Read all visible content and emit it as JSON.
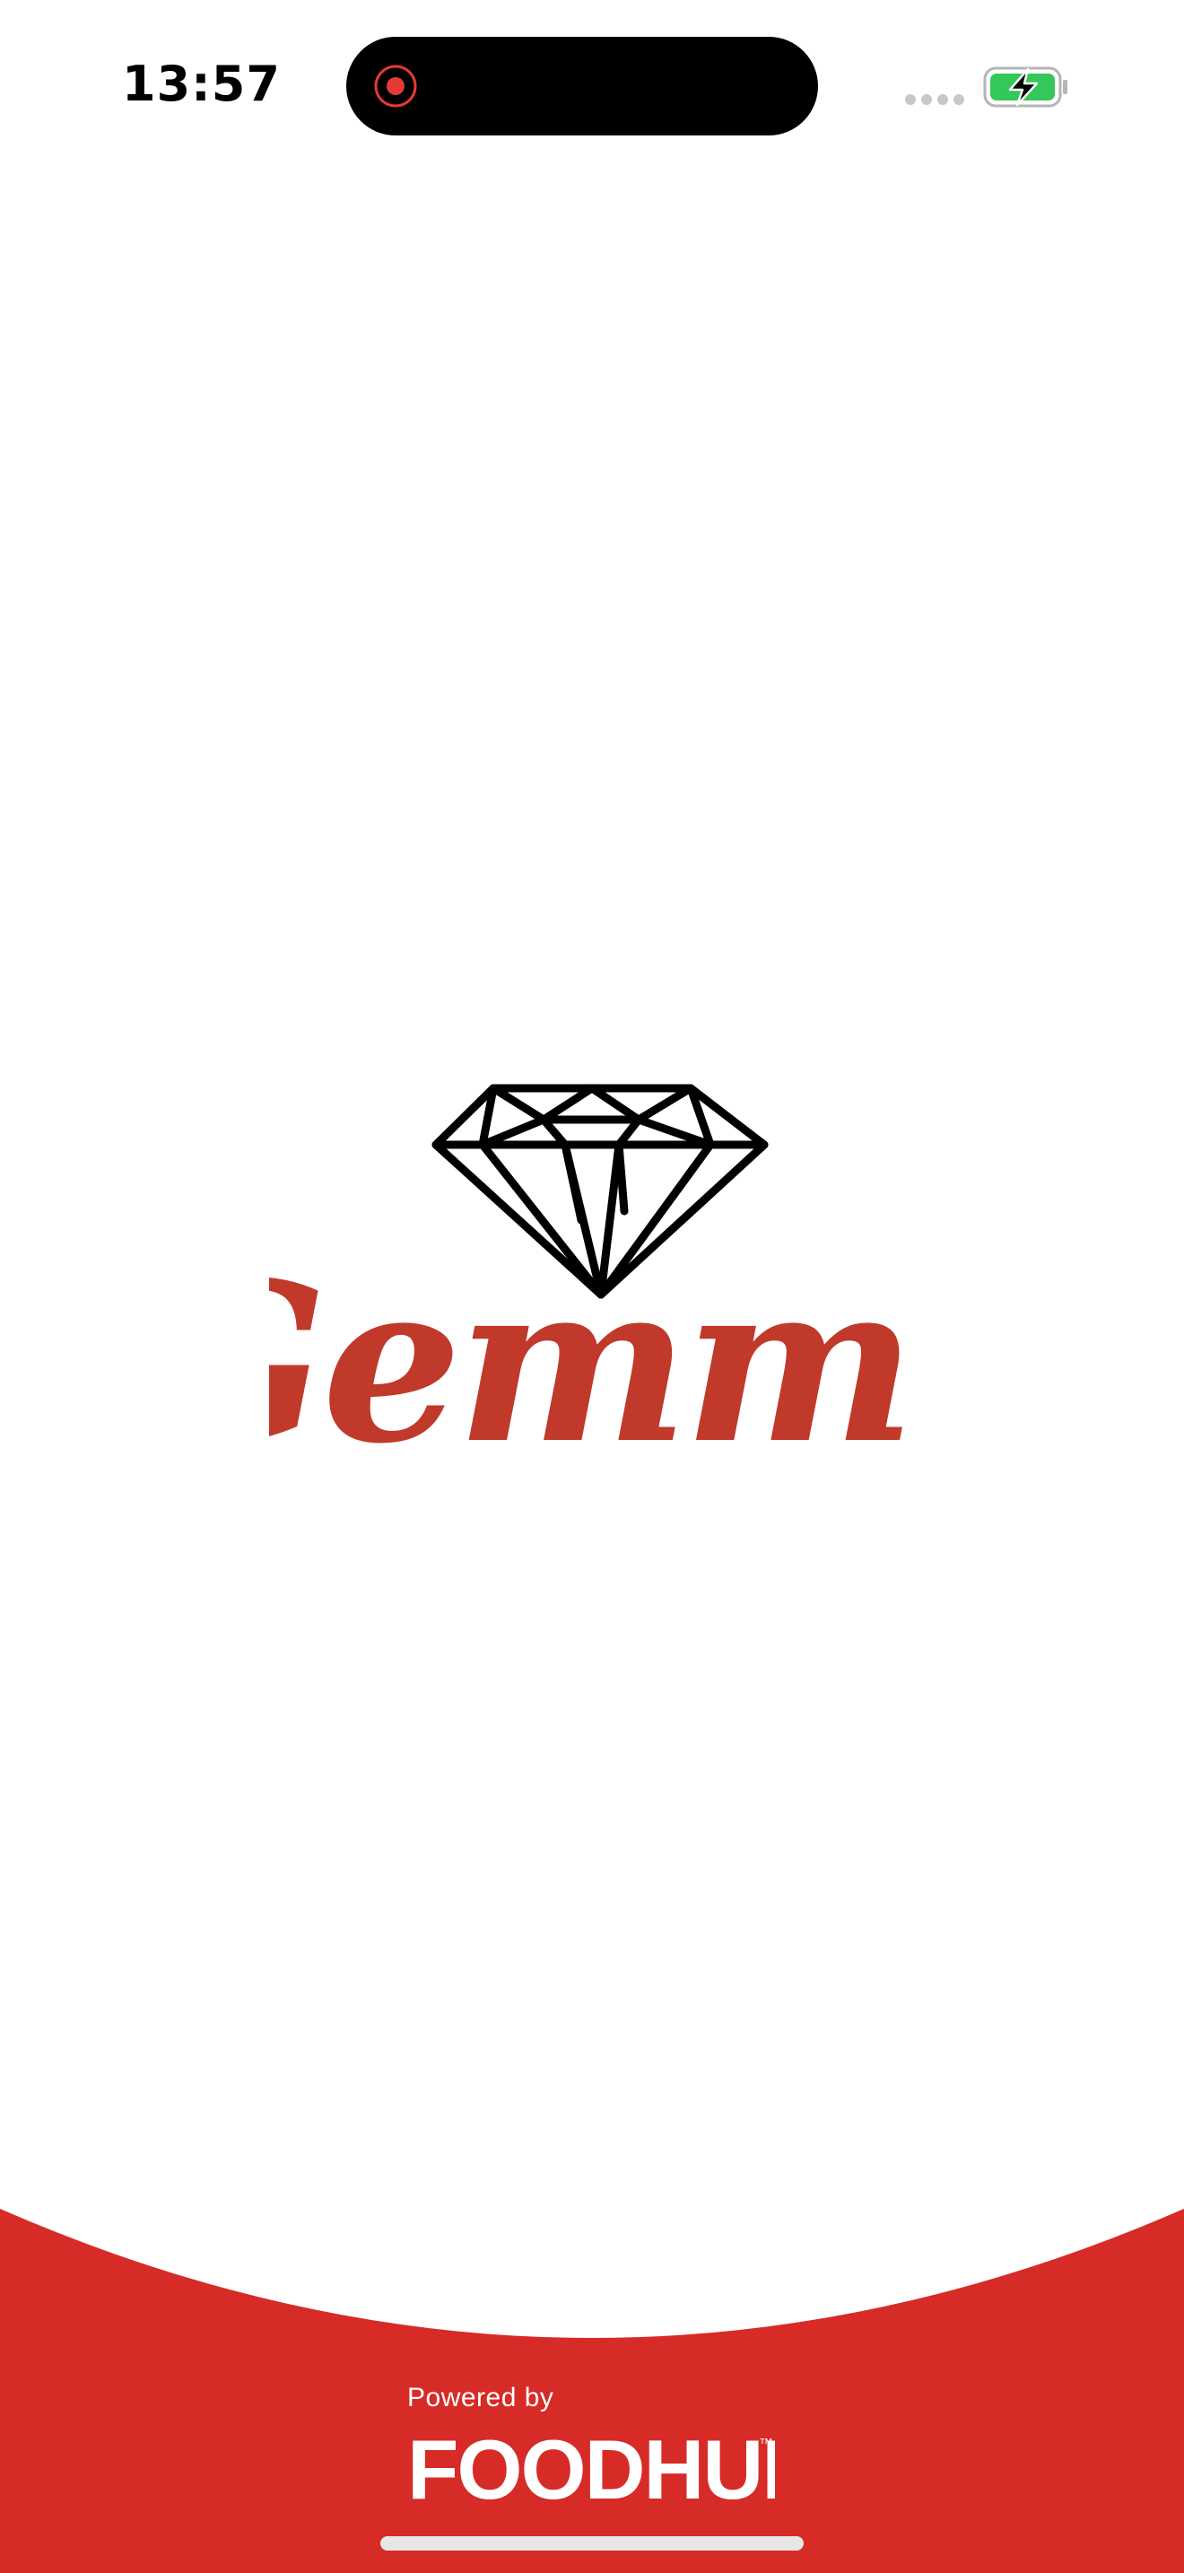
{
  "status_bar": {
    "time": "13:57"
  },
  "logo": {
    "wordmark": "Gemma",
    "icon": "diamond-icon",
    "color": "#c0392b"
  },
  "footer": {
    "powered_by": "Powered by",
    "brand": "FOODHUB",
    "trademark": "™",
    "background": "#d62b27"
  },
  "colors": {
    "background": "#ffffff",
    "battery": "#34c759",
    "recording": "#e53935"
  }
}
